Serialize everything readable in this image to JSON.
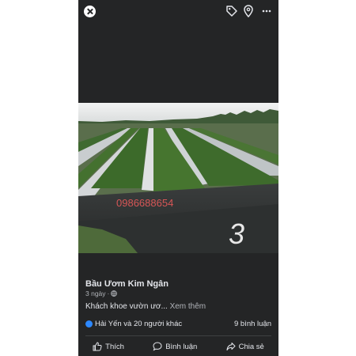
{
  "post": {
    "author": "Bầu Ươm Kim Ngân",
    "time": "3 ngày",
    "caption": "Khách khoe vườn ươ...",
    "see_more": "Xem thêm",
    "reactions_text": "Hải Yến và 20 người khác",
    "comments_text": "9 bình luận"
  },
  "photo": {
    "phone_overlay": "0986688654",
    "mark": "3"
  },
  "actions": {
    "like": "Thích",
    "comment": "Bình luận",
    "share": "Chia sẻ"
  },
  "icons": {
    "close": "close-icon",
    "tag": "tag-icon",
    "location": "location-icon",
    "more": "more-icon",
    "globe": "globe-icon",
    "like": "like-icon",
    "comment": "comment-icon",
    "share": "share-icon"
  },
  "colors": {
    "background": "#242526",
    "text": "#e4e6eb",
    "secondary_text": "#b0b3b8",
    "like_badge": "#2d88ff",
    "overlay_text": "#e85a5a"
  }
}
